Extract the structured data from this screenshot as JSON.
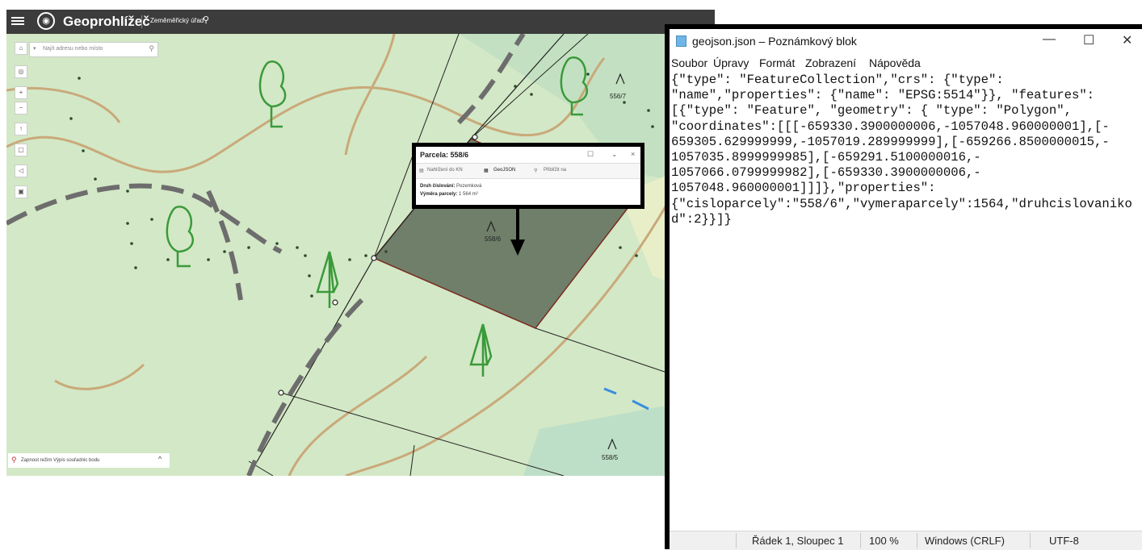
{
  "map_app": {
    "title": "Geoprohlížeč",
    "subtitle": "Zeměměřický úřad",
    "search_placeholder": "Najít adresu nebo místo",
    "tool_icons": [
      "home-icon",
      "compass-icon",
      "zoom-in-icon",
      "zoom-out-icon",
      "location-icon",
      "layers-icon",
      "measure-icon",
      "print-icon"
    ],
    "popup": {
      "title": "Parcela: 558/6",
      "tabs": [
        "Nahlížení do KN",
        "GeoJSON",
        "Přiblížit na"
      ],
      "rows": [
        {
          "label": "Druh číslování:",
          "value": "Pozemková"
        },
        {
          "label": "Výměra parcely:",
          "value": "1 564 m²"
        }
      ]
    },
    "map_labels": {
      "parcel_558_7": "556/7",
      "parcel_558_6": "558/6",
      "parcel_558_5": "558/5"
    },
    "coord_toggle": "Zapnout režim Výpis souřadnic bodu"
  },
  "notepad": {
    "title": "geojson.json – Poznámkový blok",
    "menu": [
      "Soubor",
      "Úpravy",
      "Formát",
      "Zobrazení",
      "Nápověda"
    ],
    "lines": [
      "{\"type\": \"FeatureCollection\",\"crs\": {\"type\":",
      "\"name\",\"properties\": {\"name\": \"EPSG:5514\"}}, \"features\":",
      "[{\"type\": \"Feature\", \"geometry\": { \"type\": \"Polygon\",",
      "\"coordinates\":[[[-659330.3900000006,-1057048.960000001],[-",
      "659305.629999999,-1057019.289999999],[-659266.8500000015,-",
      "1057035.8999999985],[-659291.5100000016,-",
      "1057066.0799999982],[-659330.3900000006,-",
      "1057048.960000001]]]},\"properties\":",
      "{\"cisloparcely\":\"558/6\",\"vymeraparcely\":1564,\"druhcislovaniko",
      "d\":2}}]}"
    ],
    "status": {
      "position": "Řádek 1, Sloupec 1",
      "zoom": "100 %",
      "line_endings": "Windows (CRLF)",
      "encoding": "UTF-8"
    }
  }
}
